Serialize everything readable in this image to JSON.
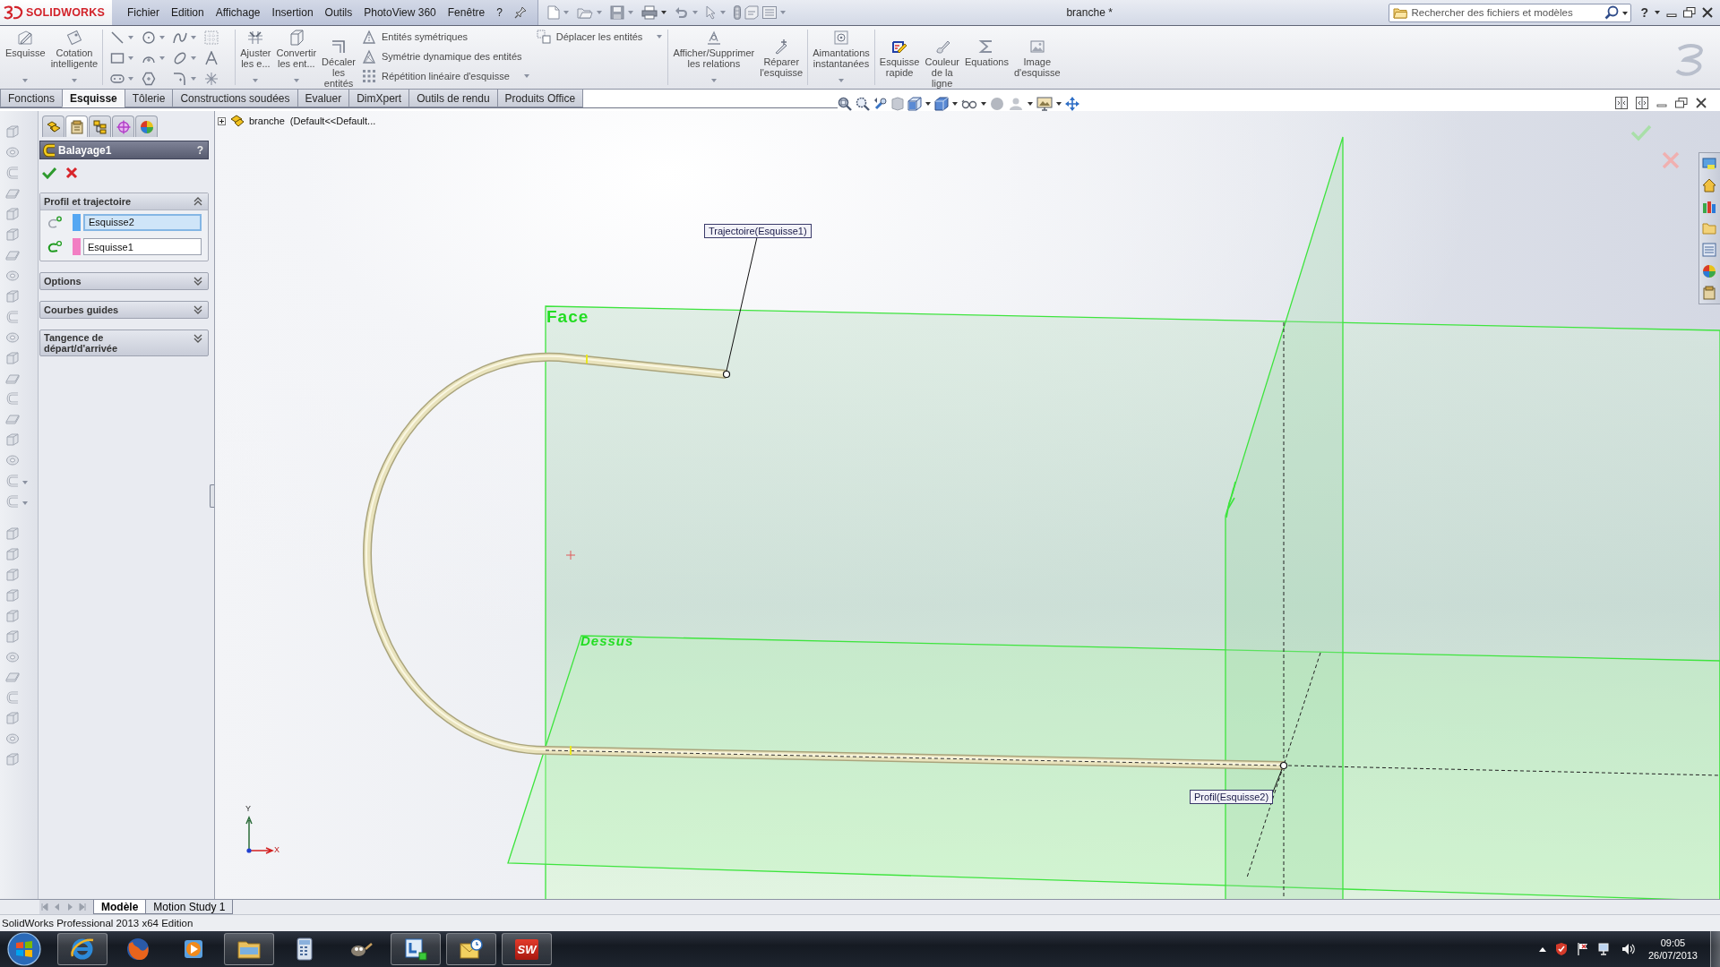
{
  "top_bar": {
    "logo": "SOLIDWORKS",
    "menu": [
      "Fichier",
      "Edition",
      "Affichage",
      "Insertion",
      "Outils",
      "PhotoView 360",
      "Fenêtre",
      "?"
    ],
    "title": "branche *",
    "search": {
      "placeholder": "Rechercher des fichiers et modèles"
    },
    "help": "?"
  },
  "ribbon": [
    {
      "kind": "large",
      "label": "Esquisse",
      "dropdown": true
    },
    {
      "kind": "large",
      "label": "Cotation\nintelligente",
      "dropdown": true
    },
    {
      "kind": "separator"
    },
    {
      "kind": "tools"
    },
    {
      "kind": "separator"
    },
    {
      "kind": "large",
      "label": "Ajuster\nles e...",
      "dropdown": true
    },
    {
      "kind": "large",
      "label": "Convertir\nles ent...",
      "dropdown": true
    },
    {
      "kind": "large",
      "label": "Décaler\nles\nentités",
      "dropdown": false
    },
    {
      "kind": "list",
      "items": [
        {
          "label": "Entités symétriques",
          "dropdown": false
        },
        {
          "label": "Symétrie dynamique des entités",
          "dropdown": false
        },
        {
          "label": "Répétition linéaire d'esquisse",
          "dropdown": true
        }
      ]
    },
    {
      "kind": "list",
      "items": [
        {
          "label": "Déplacer les entités",
          "dropdown": true
        }
      ]
    },
    {
      "kind": "separator"
    },
    {
      "kind": "large",
      "label": "Afficher/Supprimer\nles relations",
      "dropdown": true
    },
    {
      "kind": "large",
      "label": "Réparer\nl'esquisse",
      "dropdown": false
    },
    {
      "kind": "separator"
    },
    {
      "kind": "large",
      "label": "Aimantations\ninstantanées",
      "dropdown": true
    },
    {
      "kind": "separator"
    },
    {
      "kind": "large",
      "label": "Esquisse\nrapide",
      "dropdown": false
    },
    {
      "kind": "large",
      "label": "Couleur\nde la\nligne",
      "dropdown": false
    },
    {
      "kind": "large",
      "label": "Equations",
      "dropdown": false
    },
    {
      "kind": "large",
      "label": "Image\nd'esquisse",
      "dropdown": false
    }
  ],
  "command_tabs": [
    {
      "label": "Fonctions",
      "selected": false
    },
    {
      "label": "Esquisse",
      "selected": true
    },
    {
      "label": "Tôlerie",
      "selected": false
    },
    {
      "label": "Constructions soudées",
      "selected": false
    },
    {
      "label": "Evaluer",
      "selected": false
    },
    {
      "label": "DimXpert",
      "selected": false
    },
    {
      "label": "Outils de rendu",
      "selected": false
    },
    {
      "label": "Produits Office",
      "selected": false
    }
  ],
  "panel": {
    "tabs": [
      {
        "selected": false
      },
      {
        "selected": true
      },
      {
        "selected": false
      },
      {
        "selected": false
      },
      {
        "selected": false
      }
    ],
    "title": "Balayage1",
    "help": "?",
    "groups": [
      {
        "title": "Profil et trajectoire",
        "expanded": true,
        "fields": [
          {
            "kind": "profile",
            "color": "#55a7f2",
            "value": "Esquisse2",
            "selected": true
          },
          {
            "kind": "path",
            "color": "#f27ec3",
            "value": "Esquisse1",
            "selected": false
          }
        ]
      },
      {
        "title": "Options",
        "expanded": false
      },
      {
        "title": "Courbes guides",
        "expanded": false
      },
      {
        "title": "Tangence de départ/d'arrivée",
        "expanded": false
      }
    ]
  },
  "viewport": {
    "tree_item": {
      "label": "branche  (Default<<Default...",
      "expanded": false
    },
    "planes": [
      {
        "label": "Face"
      },
      {
        "label": "Dessus"
      }
    ],
    "callouts": [
      {
        "label": "Trajectoire(Esquisse1)"
      },
      {
        "label": "Profil(Esquisse2)"
      }
    ],
    "triad": {
      "y": "Y",
      "x": "X"
    }
  },
  "bottom_tabs": [
    {
      "label": "Modèle",
      "selected": true
    },
    {
      "label": "Motion Study 1",
      "selected": false
    }
  ],
  "status_bar": "SolidWorks Professional 2013 x64 Edition",
  "taskbar": {
    "apps": [
      {
        "running": true
      },
      {
        "running": false
      },
      {
        "running": false
      },
      {
        "running": true
      },
      {
        "running": false
      },
      {
        "running": false
      },
      {
        "running": true
      },
      {
        "running": true
      },
      {
        "running": true,
        "text": "SW"
      }
    ],
    "clock": {
      "time": "09:05",
      "date": "26/07/2013"
    }
  }
}
